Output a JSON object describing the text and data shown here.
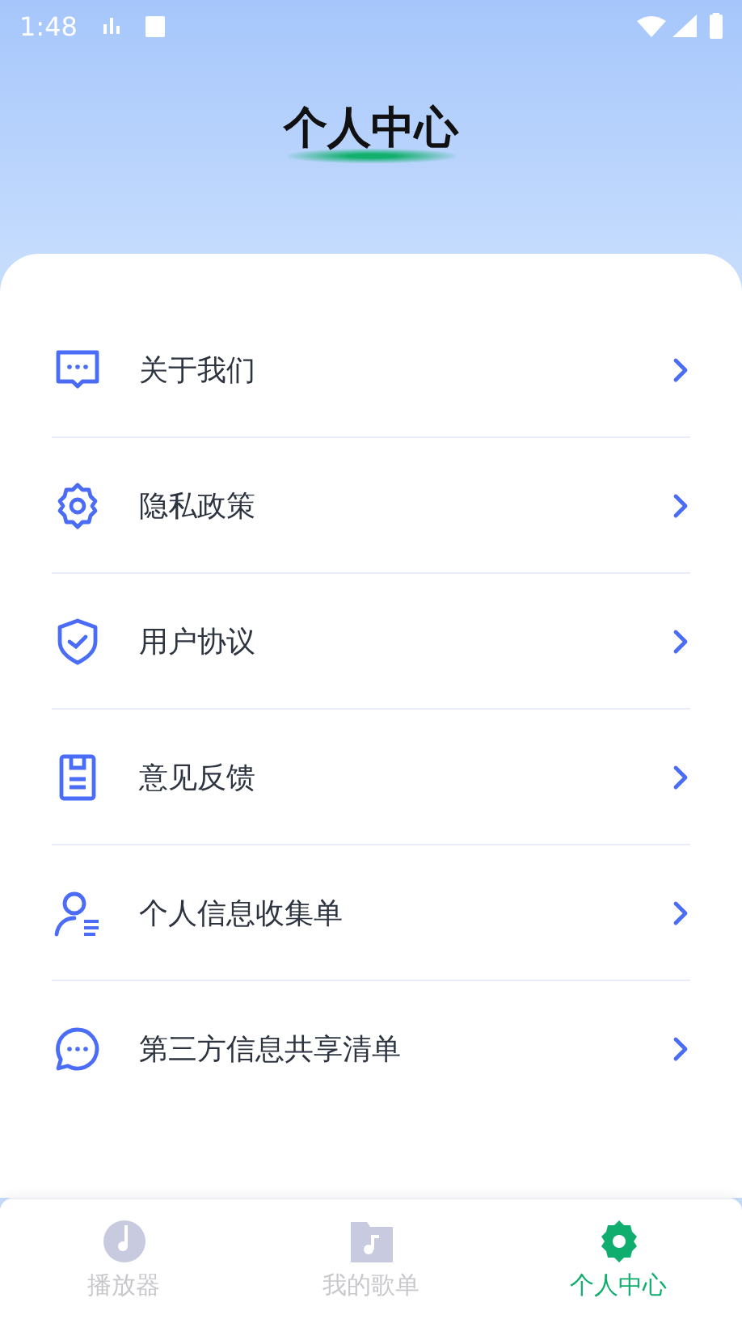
{
  "status_bar": {
    "time": "1:48"
  },
  "header": {
    "title": "个人中心"
  },
  "menu": [
    {
      "label": "关于我们",
      "kind": "chat"
    },
    {
      "label": "隐私政策",
      "kind": "gear"
    },
    {
      "label": "用户协议",
      "kind": "shield"
    },
    {
      "label": "意见反馈",
      "kind": "form"
    },
    {
      "label": "个人信息收集单",
      "kind": "user"
    },
    {
      "label": "第三方信息共享清单",
      "kind": "bubble"
    }
  ],
  "tabs": [
    {
      "label": "播放器",
      "kind": "disc",
      "selected": false
    },
    {
      "label": "我的歌单",
      "kind": "folder",
      "selected": false
    },
    {
      "label": "个人中心",
      "kind": "gear",
      "selected": true
    }
  ]
}
